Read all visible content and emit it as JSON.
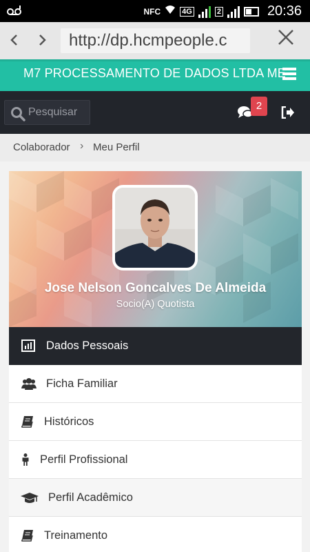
{
  "status_bar": {
    "left_icon": "voicemail-icon",
    "nfc": "NFC",
    "network": "4G",
    "sim2": "2",
    "time": "20:36"
  },
  "browser": {
    "url": "http://dp.hcmpeople.c",
    "back_icon": "chevron-left-icon",
    "forward_icon": "chevron-right-icon",
    "close_icon": "close-icon"
  },
  "header": {
    "company": "M7 PROCESSAMENTO DE DADOS LTDA ME",
    "menu_icon": "hamburger-icon",
    "accent_color": "#22bfa4"
  },
  "toolbar": {
    "search_placeholder": "Pesquisar",
    "notification_count": "2",
    "chat_icon": "chat-icon",
    "logout_icon": "logout-icon"
  },
  "breadcrumb": {
    "items": [
      "Colaborador",
      "Meu Perfil"
    ]
  },
  "profile": {
    "name": "Jose Nelson Goncalves De Almeida",
    "role": "Socio(A) Quotista"
  },
  "menu": {
    "items": [
      {
        "label": "Dados Pessoais",
        "icon": "bar-chart-icon",
        "active": true
      },
      {
        "label": "Ficha Familiar",
        "icon": "users-icon"
      },
      {
        "label": "Históricos",
        "icon": "book-icon"
      },
      {
        "label": "Perfil Profissional",
        "icon": "person-icon"
      },
      {
        "label": "Perfil Acadêmico",
        "icon": "graduation-cap-icon"
      },
      {
        "label": "Treinamento",
        "icon": "book-icon"
      }
    ]
  }
}
